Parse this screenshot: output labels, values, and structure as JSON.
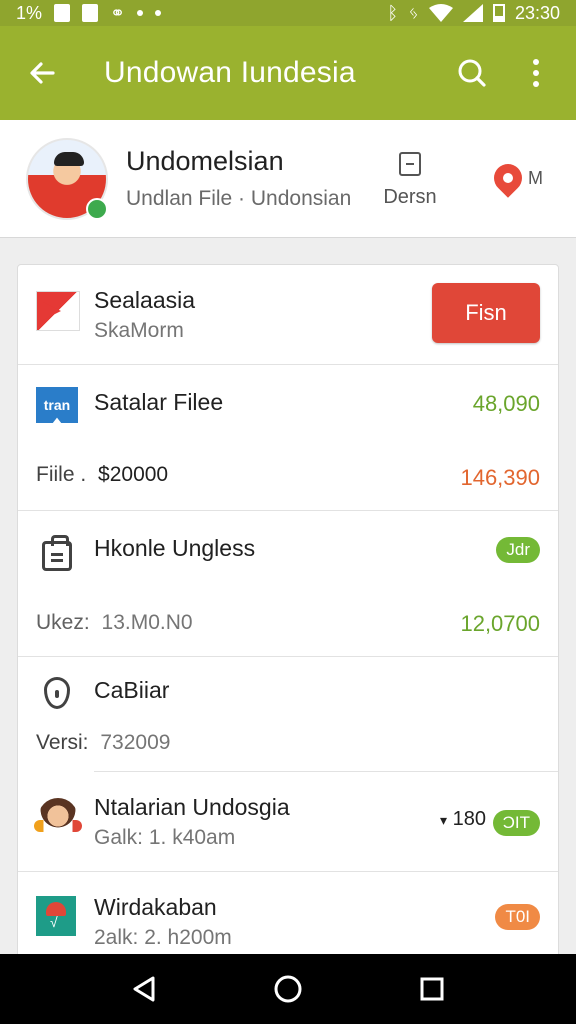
{
  "status_bar": {
    "battery_percent": "1%",
    "time": "23:30"
  },
  "app_bar": {
    "title": "Undowan Iundesia"
  },
  "profile": {
    "name": "Undomelsian",
    "subtitle": "Undlan File · Undonsian",
    "action_label": "Dersn",
    "mi_label": "M"
  },
  "list": {
    "row1": {
      "title": "Sealaasia",
      "subtitle": "SkaMorm",
      "button": "Fisn"
    },
    "row2": {
      "badge": "tran",
      "title": "Satalar Filee",
      "value_top": "48,090",
      "label": "Fiile .",
      "amount": "$20000",
      "value_bottom": "146,390"
    },
    "row3": {
      "title": "Hkonle Ungless",
      "pill": "Jdr",
      "label": "Ukez:",
      "label_value": "13.M0.N0",
      "value": "12,0700"
    },
    "row4": {
      "title": "CaBiiar",
      "label": "Versi:",
      "label_value": "732009"
    },
    "row5": {
      "title": "Ntalarian Undosgia",
      "subtitle": "Galk: 1. k40am",
      "count": "180",
      "pill": "ƆIT"
    },
    "row6": {
      "title": "Wirdakaban",
      "subtitle": "2alk: 2. h200m",
      "pill": "T0I"
    }
  },
  "colors": {
    "app_bar": "#9ab22f",
    "status_bar": "#8fa52e",
    "green_value": "#6aa52c",
    "orange_value": "#e2662f",
    "red_button": "#e04738"
  },
  "icons": {
    "back": "arrow-left-icon",
    "search": "search-icon",
    "more": "more-vertical-icon",
    "nav_back": "triangle-back-icon",
    "nav_home": "circle-home-icon",
    "nav_recents": "square-recents-icon"
  }
}
